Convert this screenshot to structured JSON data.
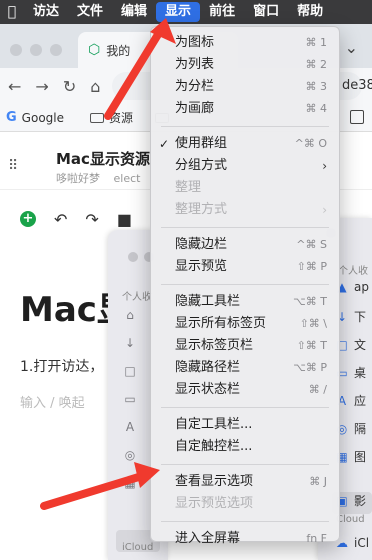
{
  "menubar": {
    "items": [
      "访达",
      "文件",
      "编辑",
      "显示",
      "前往",
      "窗口",
      "帮助"
    ],
    "active": "显示"
  },
  "browser": {
    "tab_title": "我的",
    "url_fragment": "de38s",
    "bookmarks": [
      "Google",
      "资源"
    ]
  },
  "document": {
    "title": "Mac显示资源",
    "author": "哆啦好梦",
    "meta2": "elect",
    "big_title": "Mac显",
    "paragraph": "1.打开访达，",
    "placeholder": "输入 / 唤起"
  },
  "finder_left": {
    "label1": "个人收",
    "label2": "iCloud"
  },
  "finder_right": {
    "label1": "个人收",
    "items": [
      "ap",
      "下",
      "文",
      "桌",
      "应",
      "隔",
      "图",
      "影"
    ],
    "label2": "Cloud",
    "item_icloud": "iCl"
  },
  "view_menu": {
    "groups": [
      [
        {
          "label": "为图标",
          "shortcut": "⌘ 1"
        },
        {
          "label": "为列表",
          "shortcut": "⌘ 2"
        },
        {
          "label": "为分栏",
          "shortcut": "⌘ 3"
        },
        {
          "label": "为画廊",
          "shortcut": "⌘ 4"
        }
      ],
      [
        {
          "label": "使用群组",
          "shortcut": "^⌘ O",
          "checked": true
        },
        {
          "label": "分组方式",
          "submenu": true
        },
        {
          "label": "整理",
          "disabled": true
        },
        {
          "label": "整理方式",
          "submenu": true,
          "disabled": true
        }
      ],
      [
        {
          "label": "隐藏边栏",
          "shortcut": "^⌘ S"
        },
        {
          "label": "显示预览",
          "shortcut": "⇧⌘ P"
        }
      ],
      [
        {
          "label": "隐藏工具栏",
          "shortcut": "⌥⌘ T"
        },
        {
          "label": "显示所有标签页",
          "shortcut": "⇧⌘ \\"
        },
        {
          "label": "显示标签页栏",
          "shortcut": "⇧⌘ T"
        },
        {
          "label": "隐藏路径栏",
          "shortcut": "⌥⌘ P"
        },
        {
          "label": "显示状态栏",
          "shortcut": "⌘ /"
        }
      ],
      [
        {
          "label": "自定工具栏..."
        },
        {
          "label": "自定触控栏..."
        }
      ],
      [
        {
          "label": "查看显示选项",
          "shortcut": "⌘ J"
        },
        {
          "label": "显示预览选项",
          "disabled": true
        }
      ],
      [
        {
          "label": "进入全屏幕",
          "shortcut": "fn F"
        }
      ]
    ]
  },
  "colors": {
    "menubar_bg": "#3a3a3c",
    "menubar_active": "#2f6fe4",
    "annotation": "#f03a2e"
  }
}
